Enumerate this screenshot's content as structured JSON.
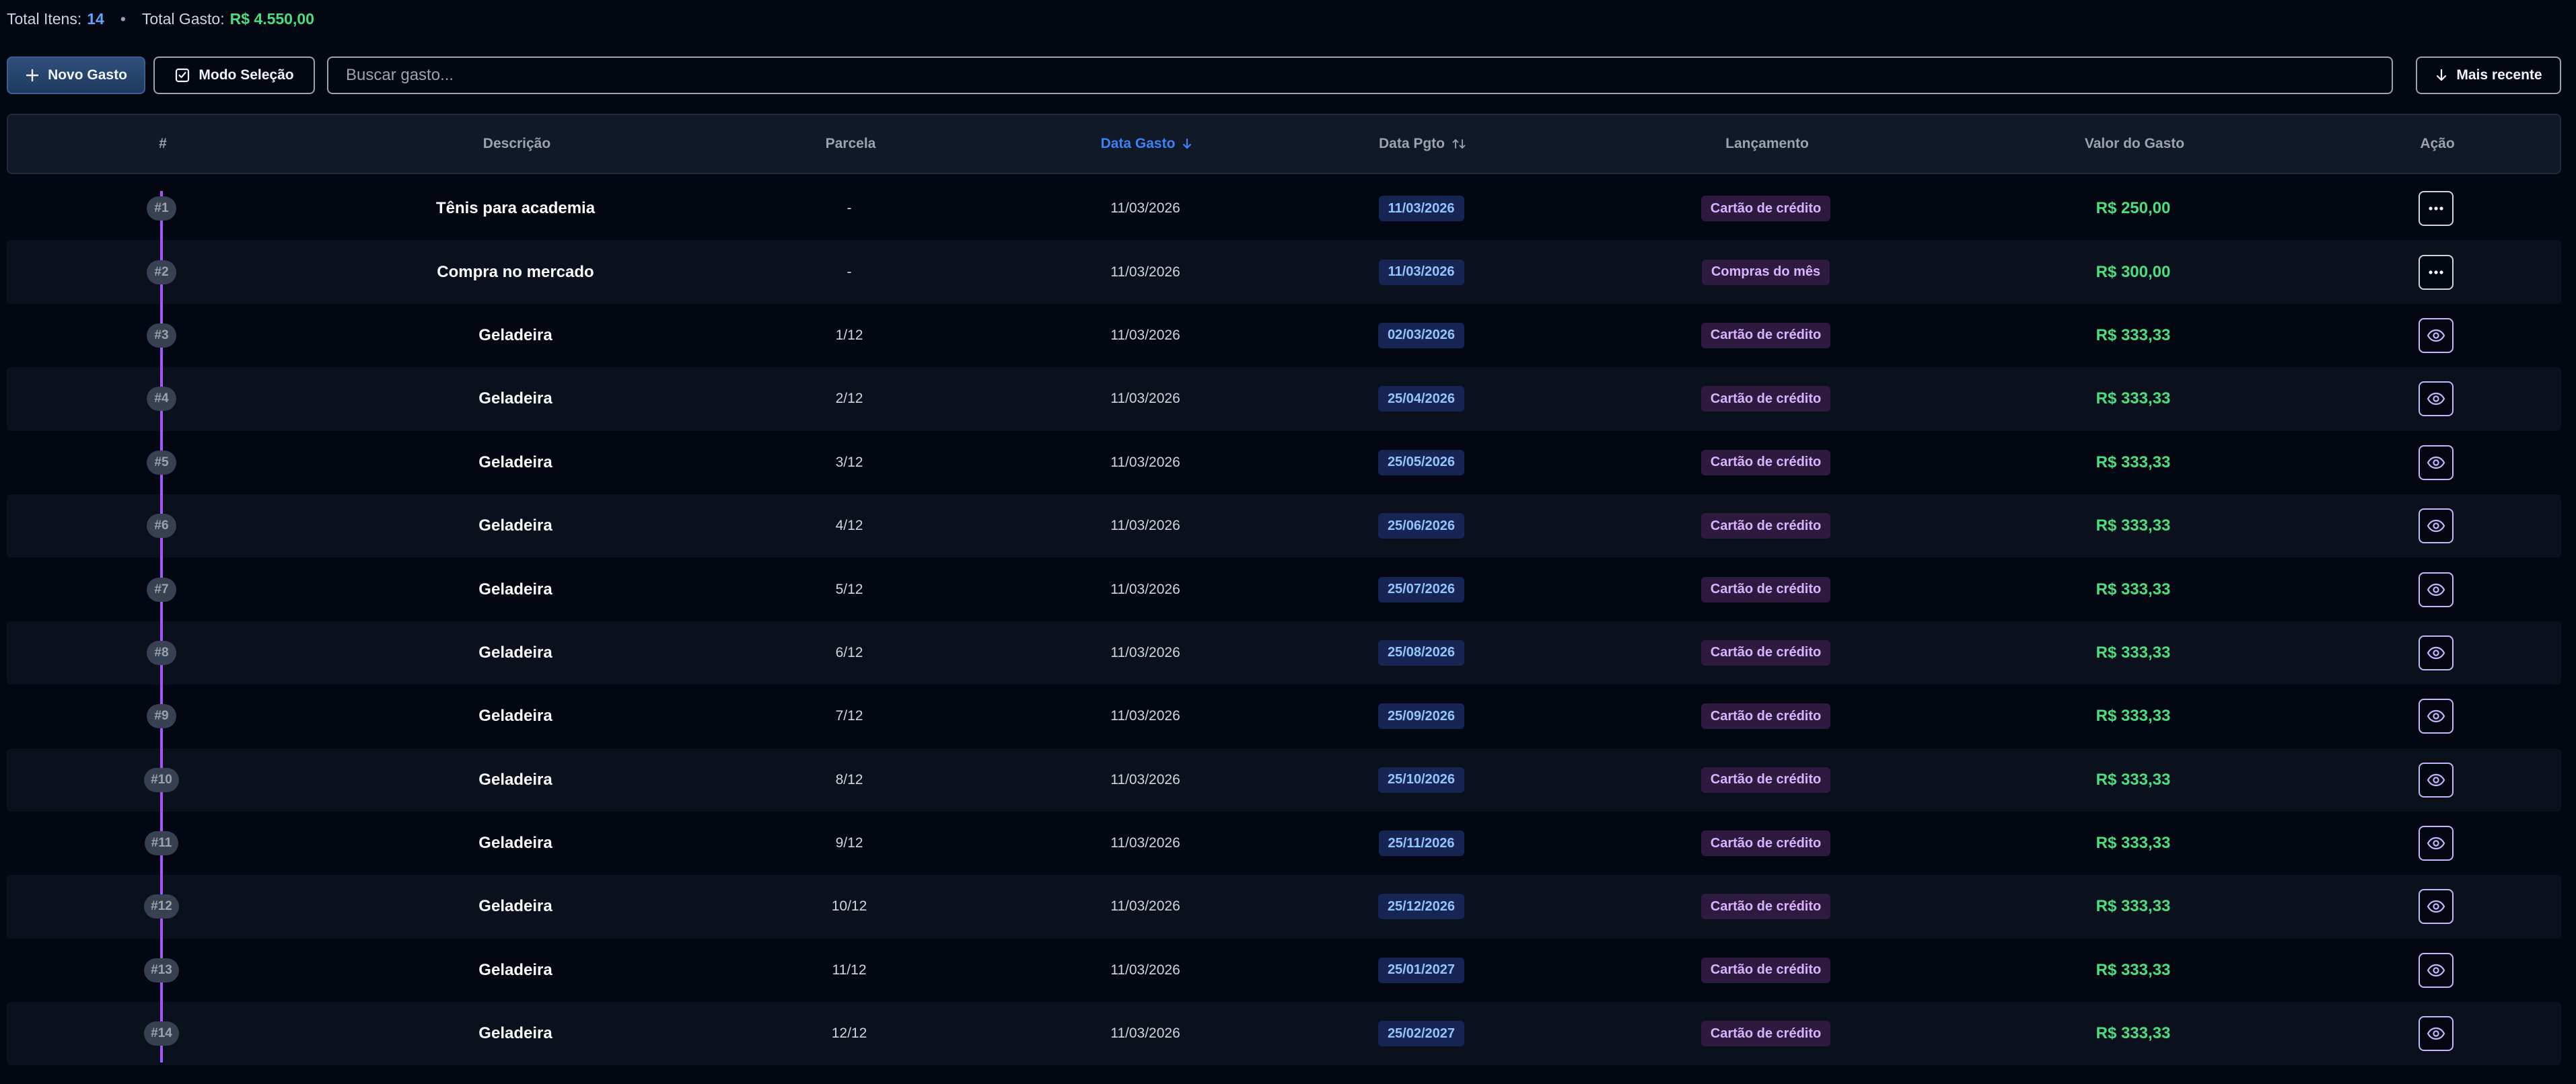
{
  "summary": {
    "items_label": "Total Itens:",
    "items_value": "14",
    "total_label": "Total Gasto:",
    "total_value": "R$ 4.550,00",
    "separator": "•"
  },
  "toolbar": {
    "new_label": "Novo Gasto",
    "select_label": "Modo Seleção",
    "search_placeholder": "Buscar gasto...",
    "sort_label": "Mais recente"
  },
  "table": {
    "headers": {
      "num": "#",
      "descricao": "Descrição",
      "parcela": "Parcela",
      "data_gasto": "Data Gasto",
      "data_pgto": "Data Pgto",
      "lancamento": "Lançamento",
      "valor": "Valor do Gasto",
      "acao": "Ação"
    },
    "rows": [
      {
        "num": "#1",
        "descricao": "Tênis para academia",
        "parcela": "-",
        "data_gasto": "11/03/2026",
        "data_pgto": "11/03/2026",
        "lancamento": "Cartão de crédito",
        "valor": "R$ 250,00",
        "action_icon": "more-icon"
      },
      {
        "num": "#2",
        "descricao": "Compra no mercado",
        "parcela": "-",
        "data_gasto": "11/03/2026",
        "data_pgto": "11/03/2026",
        "lancamento": "Compras do mês",
        "valor": "R$ 300,00",
        "action_icon": "more-icon"
      },
      {
        "num": "#3",
        "descricao": "Geladeira",
        "parcela": "1/12",
        "data_gasto": "11/03/2026",
        "data_pgto": "02/03/2026",
        "lancamento": "Cartão de crédito",
        "valor": "R$ 333,33",
        "action_icon": "eye-icon"
      },
      {
        "num": "#4",
        "descricao": "Geladeira",
        "parcela": "2/12",
        "data_gasto": "11/03/2026",
        "data_pgto": "25/04/2026",
        "lancamento": "Cartão de crédito",
        "valor": "R$ 333,33",
        "action_icon": "eye-icon"
      },
      {
        "num": "#5",
        "descricao": "Geladeira",
        "parcela": "3/12",
        "data_gasto": "11/03/2026",
        "data_pgto": "25/05/2026",
        "lancamento": "Cartão de crédito",
        "valor": "R$ 333,33",
        "action_icon": "eye-icon"
      },
      {
        "num": "#6",
        "descricao": "Geladeira",
        "parcela": "4/12",
        "data_gasto": "11/03/2026",
        "data_pgto": "25/06/2026",
        "lancamento": "Cartão de crédito",
        "valor": "R$ 333,33",
        "action_icon": "eye-icon"
      },
      {
        "num": "#7",
        "descricao": "Geladeira",
        "parcela": "5/12",
        "data_gasto": "11/03/2026",
        "data_pgto": "25/07/2026",
        "lancamento": "Cartão de crédito",
        "valor": "R$ 333,33",
        "action_icon": "eye-icon"
      },
      {
        "num": "#8",
        "descricao": "Geladeira",
        "parcela": "6/12",
        "data_gasto": "11/03/2026",
        "data_pgto": "25/08/2026",
        "lancamento": "Cartão de crédito",
        "valor": "R$ 333,33",
        "action_icon": "eye-icon"
      },
      {
        "num": "#9",
        "descricao": "Geladeira",
        "parcela": "7/12",
        "data_gasto": "11/03/2026",
        "data_pgto": "25/09/2026",
        "lancamento": "Cartão de crédito",
        "valor": "R$ 333,33",
        "action_icon": "eye-icon"
      },
      {
        "num": "#10",
        "descricao": "Geladeira",
        "parcela": "8/12",
        "data_gasto": "11/03/2026",
        "data_pgto": "25/10/2026",
        "lancamento": "Cartão de crédito",
        "valor": "R$ 333,33",
        "action_icon": "eye-icon"
      },
      {
        "num": "#11",
        "descricao": "Geladeira",
        "parcela": "9/12",
        "data_gasto": "11/03/2026",
        "data_pgto": "25/11/2026",
        "lancamento": "Cartão de crédito",
        "valor": "R$ 333,33",
        "action_icon": "eye-icon"
      },
      {
        "num": "#12",
        "descricao": "Geladeira",
        "parcela": "10/12",
        "data_gasto": "11/03/2026",
        "data_pgto": "25/12/2026",
        "lancamento": "Cartão de crédito",
        "valor": "R$ 333,33",
        "action_icon": "eye-icon"
      },
      {
        "num": "#13",
        "descricao": "Geladeira",
        "parcela": "11/12",
        "data_gasto": "11/03/2026",
        "data_pgto": "25/01/2027",
        "lancamento": "Cartão de crédito",
        "valor": "R$ 333,33",
        "action_icon": "eye-icon"
      },
      {
        "num": "#14",
        "descricao": "Geladeira",
        "parcela": "12/12",
        "data_gasto": "11/03/2026",
        "data_pgto": "25/02/2027",
        "lancamento": "Cartão de crédito",
        "valor": "R$ 333,33",
        "action_icon": "eye-icon"
      }
    ]
  },
  "colors": {
    "background": "#030712",
    "accent_blue": "#3b82f6",
    "value_green": "#4ade80",
    "timeline_purple": "#a855f7"
  }
}
